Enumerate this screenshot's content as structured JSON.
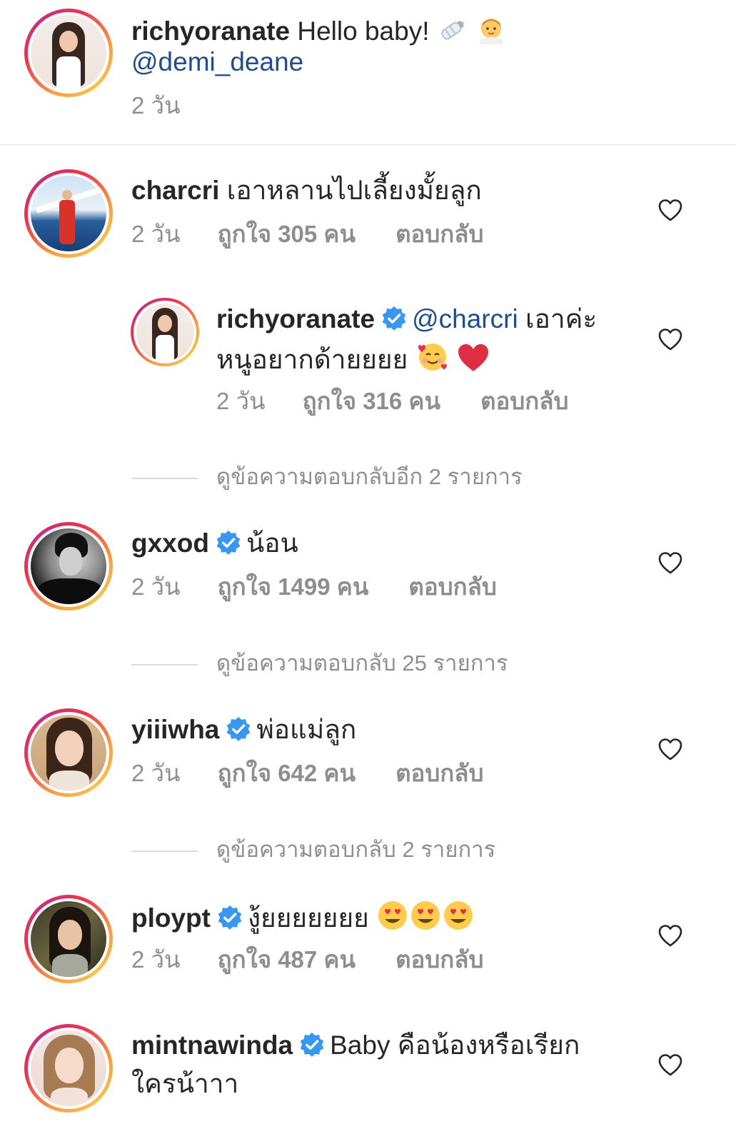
{
  "caption": {
    "username": "richyoranate",
    "text": "Hello baby!",
    "mention": "@demi_deane",
    "time": "2 วัน"
  },
  "comments": [
    {
      "username": "charcri",
      "verified": false,
      "text": "เอาหลานไปเลี้ยงมั้ยลูก",
      "time": "2 วัน",
      "likes": "ถูกใจ 305 คน",
      "reply": "ตอบกลับ",
      "reply_comment": {
        "username": "richyoranate",
        "verified": true,
        "mention": "@charcri",
        "text1": "เอาค่ะ",
        "text2": "หนูอยากด้ายยยย",
        "time": "2 วัน",
        "likes": "ถูกใจ 316 คน",
        "reply": "ตอบกลับ"
      },
      "more_replies": "ดูข้อความตอบกลับอีก 2 รายการ"
    },
    {
      "username": "gxxod",
      "verified": true,
      "text": "น้อน",
      "time": "2 วัน",
      "likes": "ถูกใจ 1499 คน",
      "reply": "ตอบกลับ",
      "more_replies": "ดูข้อความตอบกลับ 25 รายการ"
    },
    {
      "username": "yiiiwha",
      "verified": true,
      "text": "พ่อแม่ลูก",
      "time": "2 วัน",
      "likes": "ถูกใจ 642 คน",
      "reply": "ตอบกลับ",
      "more_replies": "ดูข้อความตอบกลับ 2 รายการ"
    },
    {
      "username": "ploypt",
      "verified": true,
      "text": "งู้ยยยยยยย",
      "time": "2 วัน",
      "likes": "ถูกใจ 487 คน",
      "reply": "ตอบกลับ"
    },
    {
      "username": "mintnawinda",
      "verified": true,
      "text1": "Baby คือน้องหรือเรียก",
      "text2": "ใครน้าาา"
    }
  ],
  "icons": {
    "heart": "heart-outline-icon",
    "verified": "verified-badge-icon",
    "accent": "#3897f0"
  }
}
